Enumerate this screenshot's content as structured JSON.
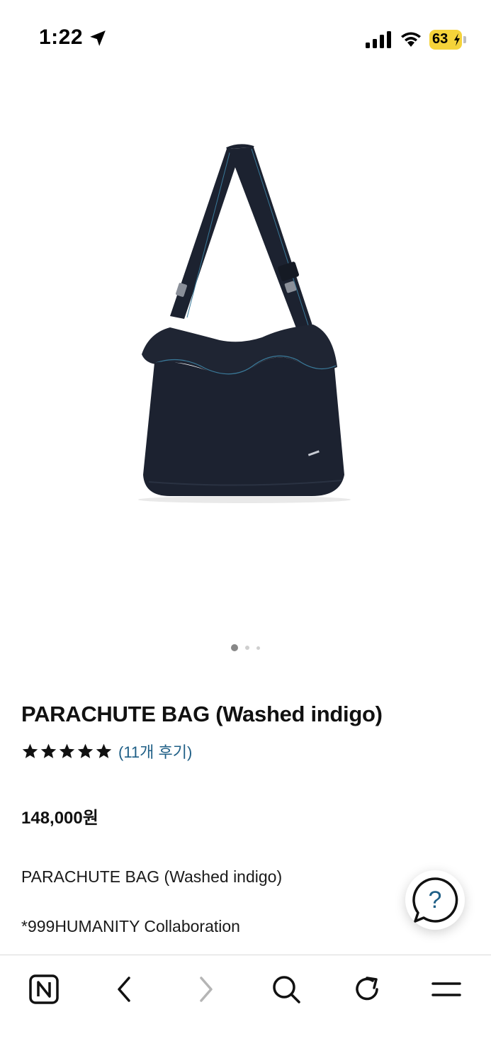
{
  "status_bar": {
    "time": "1:22",
    "battery": "63",
    "battery_color": "#f5d33a"
  },
  "carousel": {
    "total_dots": 3,
    "active_index": 0
  },
  "product": {
    "title": "PARACHUTE BAG (Washed indigo)",
    "rating": 5,
    "review_link": "(11개 후기)",
    "price": "148,000원",
    "description": [
      "PARACHUTE BAG (Washed indigo)",
      "*999HUMANITY Collaboration"
    ]
  },
  "help_button": {
    "glyph": "?"
  },
  "toolbar": {
    "items": [
      "n-logo-icon",
      "back-chevron-icon",
      "forward-chevron-icon",
      "search-icon",
      "reload-icon",
      "menu-icon"
    ]
  },
  "colors": {
    "link": "#1f5f86",
    "bag": "#1c2230",
    "stitch": "#3a7a9a"
  }
}
